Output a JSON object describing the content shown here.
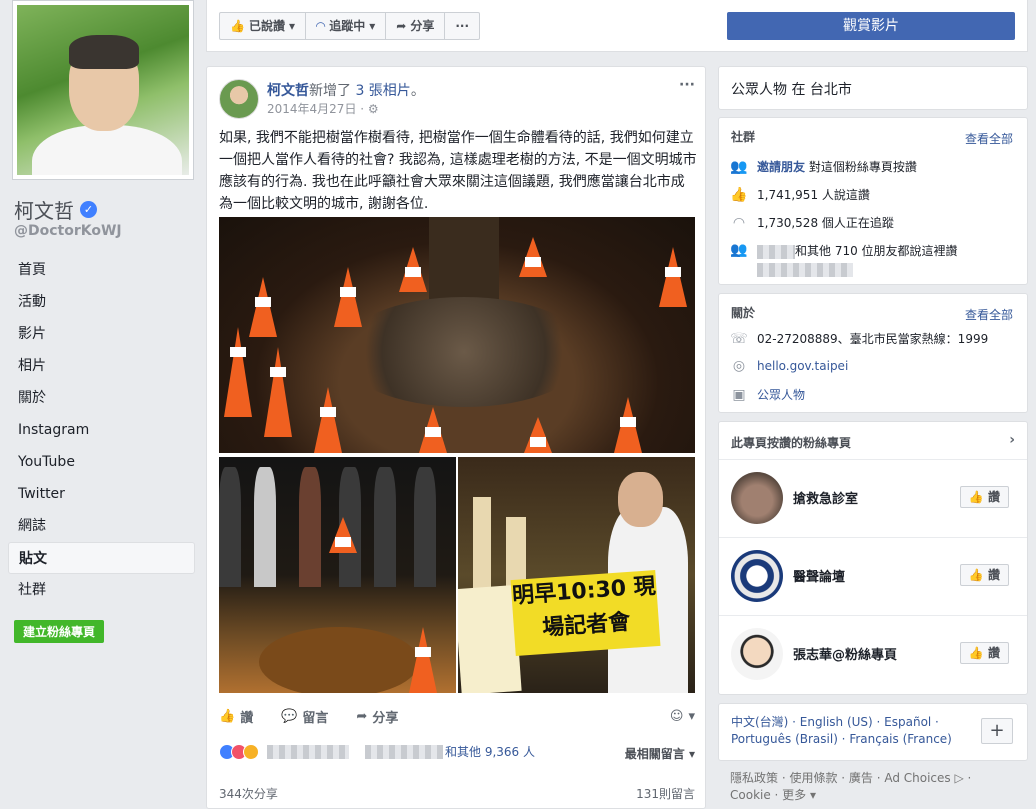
{
  "profile": {
    "name": "柯文哲",
    "handle": "@DoctorKoWJ",
    "verified_mark": "✓",
    "create_page": "建立粉絲專頁"
  },
  "nav": [
    {
      "label": "首頁"
    },
    {
      "label": "活動"
    },
    {
      "label": "影片"
    },
    {
      "label": "相片"
    },
    {
      "label": "關於"
    },
    {
      "label": "Instagram"
    },
    {
      "label": "YouTube"
    },
    {
      "label": "Twitter"
    },
    {
      "label": "網誌"
    },
    {
      "label": "貼文",
      "active": true
    },
    {
      "label": "社群"
    }
  ],
  "action_bar": {
    "liked": "已說讚",
    "following": "追蹤中",
    "share": "分享",
    "more": "···",
    "watch_video": "觀賞影片"
  },
  "post": {
    "author": "柯文哲",
    "action_prefix": "新增了",
    "action_link": "3 張相片",
    "action_suffix": "。",
    "date": "2014年4月27日 ·",
    "menu": "···",
    "text": "如果, 我們不能把樹當作樹看待, 把樹當作一個生命體看待的話, 我們如何建立一個把人當作人看待的社會? 我認為, 這樣處理老樹的方法, 不是一個文明城市應該有的行為. 我也在此呼籲社會大眾來關注這個議題, 我們應當讓台北市成為一個比較文明的城市, 謝謝各位.",
    "sign_text": "明早10:30 現場記者會",
    "actions": {
      "like": "讚",
      "comment": "留言",
      "share": "分享"
    },
    "reactions_text": "和其他 9,366 人",
    "relevance": "最相關留言 ▾",
    "shares": "344次分享",
    "comments": "131則留言"
  },
  "right": {
    "category": "公眾人物 在 台北市",
    "community": {
      "title": "社群",
      "see_all": "查看全部",
      "invite_link": "邀請朋友",
      "invite_text": "對這個粉絲專頁按讚",
      "likes": "1,741,951 人說這讚",
      "follows": "1,730,528 個人正在追蹤",
      "friends": "和其他 710 位朋友都說這裡讚"
    },
    "about": {
      "title": "關於",
      "see_all": "查看全部",
      "phone": "02-27208889、臺北市民當家熱線：1999",
      "website": "hello.gov.taipei",
      "category": "公眾人物"
    },
    "liked_pages": {
      "title": "此專頁按讚的粉絲專頁",
      "like_label": "讚",
      "items": [
        {
          "name": "搶救急診室"
        },
        {
          "name": "醫聲論壇"
        },
        {
          "name": "張志華@粉絲專頁"
        }
      ]
    },
    "languages": {
      "line1": "中文(台灣) · English (US) · Español ·",
      "line2": "Português (Brasil) · Français (France)",
      "plus": "+"
    },
    "footer": {
      "line1": "隱私政策 · 使用條款 · 廣告 · Ad Choices ▷ ·",
      "line2": "Cookie · 更多 ▾"
    }
  },
  "colors": {
    "fb_blue": "#4267b2",
    "link": "#365899",
    "green": "#42b72a"
  }
}
